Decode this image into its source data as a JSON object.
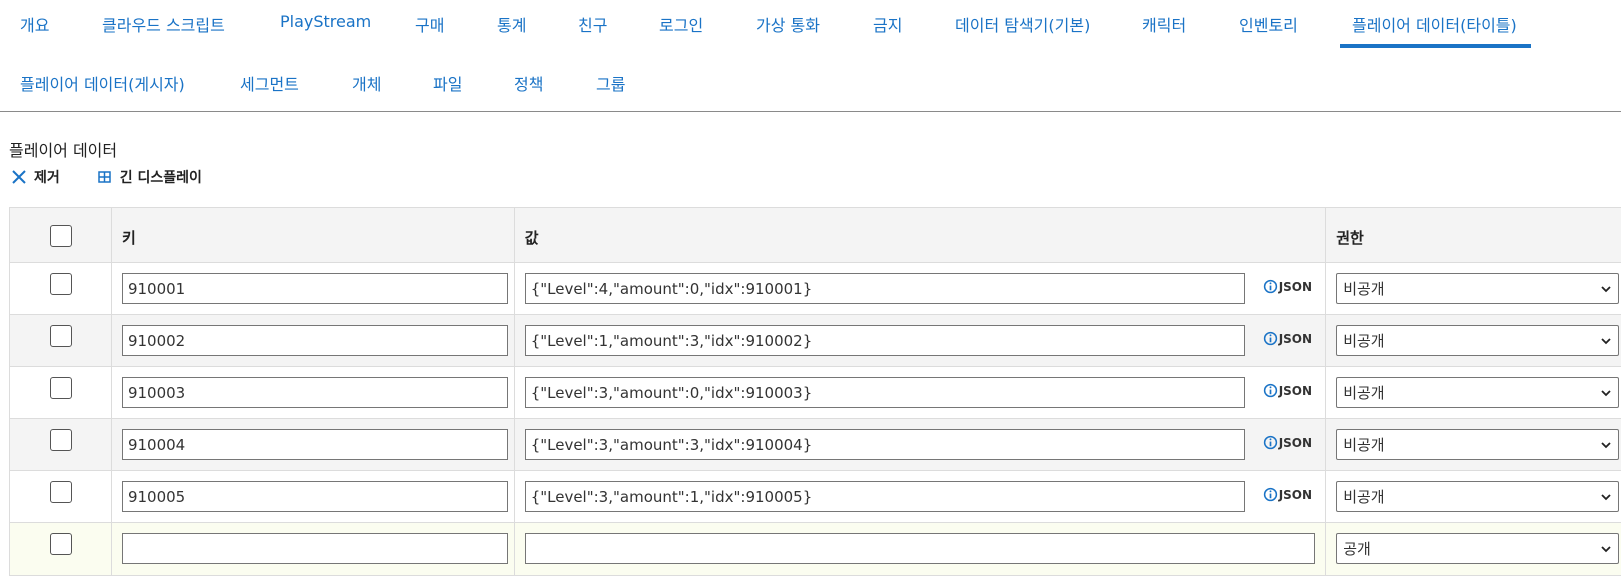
{
  "tabs": {
    "row1": [
      "개요",
      "클라우드 스크립트",
      "PlayStream",
      "구매",
      "통계",
      "친구",
      "로그인",
      "가상 통화",
      "금지",
      "데이터 탐색기(기본)",
      "캐릭터",
      "인벤토리",
      "플레이어 데이터(타이틀)"
    ],
    "row2": [
      "플레이어 데이터(게시자)",
      "세그먼트",
      "개체",
      "파일",
      "정책",
      "그룹"
    ],
    "active": "플레이어 데이터(타이틀)"
  },
  "section": {
    "title": "플레이어 데이터",
    "remove_label": "제거",
    "long_display_label": "긴 디스플레이"
  },
  "table": {
    "headers": {
      "key": "키",
      "value": "값",
      "permission": "권한"
    },
    "json_label": "JSON",
    "rows": [
      {
        "key": "910001",
        "value": "{\"Level\":4,\"amount\":0,\"idx\":910001}",
        "permission": "비공개"
      },
      {
        "key": "910002",
        "value": "{\"Level\":1,\"amount\":3,\"idx\":910002}",
        "permission": "비공개"
      },
      {
        "key": "910003",
        "value": "{\"Level\":3,\"amount\":0,\"idx\":910003}",
        "permission": "비공개"
      },
      {
        "key": "910004",
        "value": "{\"Level\":3,\"amount\":3,\"idx\":910004}",
        "permission": "비공개"
      },
      {
        "key": "910005",
        "value": "{\"Level\":3,\"amount\":1,\"idx\":910005}",
        "permission": "비공개"
      }
    ],
    "new_row": {
      "key": "",
      "value": "",
      "permission": "공개"
    }
  },
  "colors": {
    "accent": "#1a73c6",
    "row_alt": "#f4f4f4",
    "new_row_bg": "#fbfdf0",
    "border": "#dcdcdc"
  },
  "icons": {
    "remove": "close-icon",
    "long_display": "grid-icon",
    "json_info": "info-circle-icon",
    "select": "chevron-down-icon"
  }
}
